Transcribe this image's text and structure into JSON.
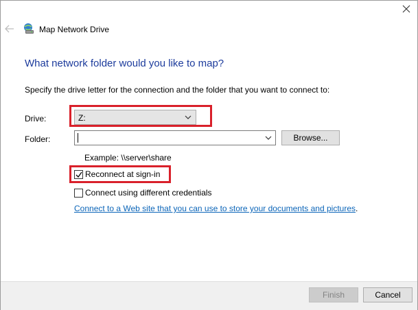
{
  "window": {
    "title": "Map Network Drive",
    "icons": {
      "back": "back-arrow-icon",
      "title": "network-drive-icon",
      "close": "close-icon"
    }
  },
  "main": {
    "heading": "What network folder would you like to map?",
    "instruction": "Specify the drive letter for the connection and the folder that you want to connect to:"
  },
  "form": {
    "drive_label": "Drive:",
    "drive_value": "Z:",
    "folder_label": "Folder:",
    "folder_value": "",
    "browse_label": "Browse...",
    "example": "Example: \\\\server\\share",
    "reconnect_label": "Reconnect at sign-in",
    "reconnect_checked": true,
    "credentials_label": "Connect using different credentials",
    "credentials_checked": false,
    "web_link": "Connect to a Web site that you can use to store your documents and pictures",
    "web_link_suffix": "."
  },
  "footer": {
    "finish_label": "Finish",
    "finish_enabled": false,
    "cancel_label": "Cancel"
  },
  "colors": {
    "heading": "#1c3b9c",
    "link": "#0a64b8",
    "highlight": "#d9202a"
  }
}
